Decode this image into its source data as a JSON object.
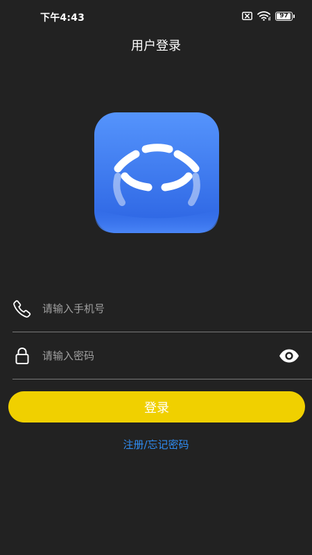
{
  "status_bar": {
    "time": "下午4:43",
    "battery_percent": 97,
    "battery_label": "97",
    "icons": [
      "sim-missing-icon",
      "wifi-icon",
      "battery-icon"
    ]
  },
  "header": {
    "title": "用户登录"
  },
  "logo": {
    "icon": "app-logo-icon",
    "colors": {
      "gradient_top": "#4E8FFB",
      "gradient_bottom": "#2C66E6",
      "foreground": "#ffffff"
    }
  },
  "form": {
    "phone": {
      "icon": "phone-icon",
      "placeholder": "请输入手机号",
      "value": ""
    },
    "password": {
      "icon": "lock-icon",
      "placeholder": "请输入密码",
      "value": "",
      "toggle_icon": "eye-icon"
    },
    "login_label": "登录",
    "register_forgot_label": "注册/忘记密码"
  },
  "colors": {
    "background": "#222222",
    "accent_button": "#F0D000",
    "link": "#2F8CF2",
    "divider": "#7a7a7a"
  }
}
